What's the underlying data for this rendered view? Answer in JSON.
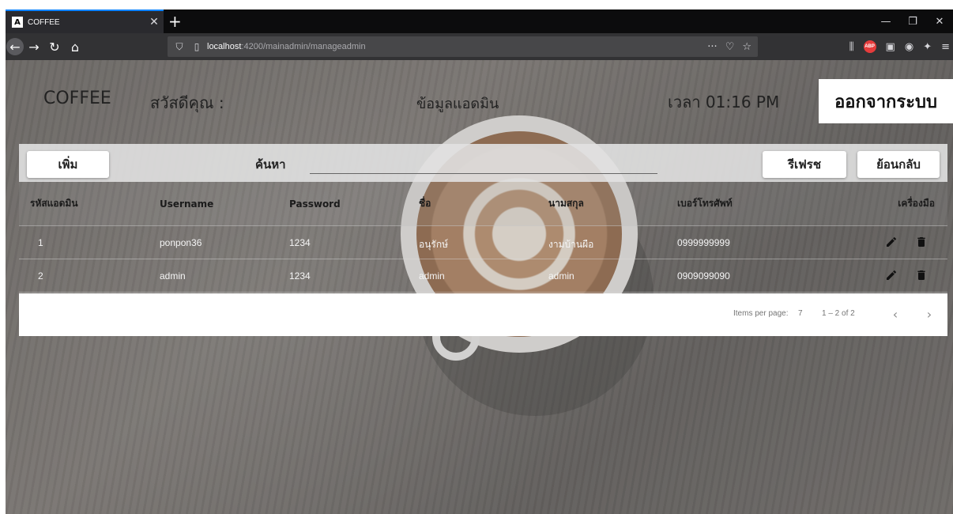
{
  "browser": {
    "tab_title": "COFFEE",
    "tab_favicon": "A",
    "url_host": "localhost",
    "url_rest": ":4200/mainadmin/manageadmin",
    "new_tab_symbol": "+",
    "more_symbol": "···"
  },
  "header": {
    "brand": "COFFEE",
    "greeting": "สวัสดีคุณ :",
    "title": "ข้อมูลแอดมิน",
    "clock": "เวลา 01:16 PM",
    "logout_label": "ออกจากระบบ"
  },
  "toolbar": {
    "add_label": "เพิ่ม",
    "search_label": "ค้นหา",
    "search_value": "",
    "refresh_label": "รีเฟรช",
    "back_label": "ย้อนกลับ"
  },
  "table": {
    "columns": [
      "รหัสแอดมิน",
      "Username",
      "Password",
      "ชื่อ",
      "นามสกุล",
      "เบอร์โทรศัพท์",
      "เครื่องมือ"
    ],
    "rows": [
      {
        "id": "1",
        "username": "ponpon36",
        "password": "1234",
        "first_name": "อนุรักษ์",
        "last_name": "งามบ้านผือ",
        "phone": "0999999999"
      },
      {
        "id": "2",
        "username": "admin",
        "password": "1234",
        "first_name": "admin",
        "last_name": "admin",
        "phone": "0909099090"
      }
    ]
  },
  "paginator": {
    "items_per_page_label": "Items per page:",
    "items_per_page": "7",
    "range_label": "1 – 2 of 2"
  },
  "colors": {
    "accent_tab": "#0a84ff",
    "browser_dark": "#0c0c0d",
    "navbar": "#323234"
  },
  "icons": {
    "edit": "pencil-icon",
    "delete": "trash-icon"
  }
}
